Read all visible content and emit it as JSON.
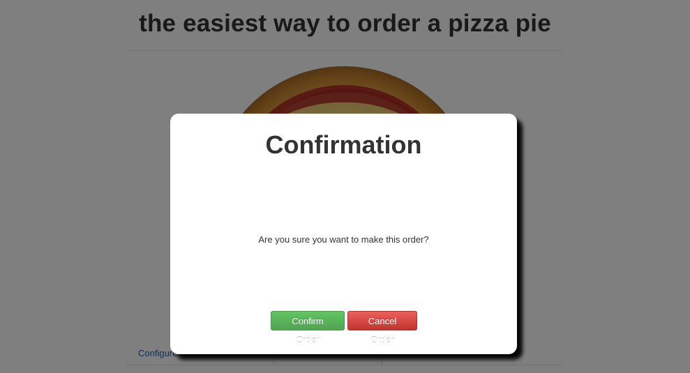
{
  "page": {
    "title": "the easiest way to order a pizza pie",
    "config_link": "Configure"
  },
  "modal": {
    "title": "Confirmation",
    "message": "Are you sure you want to make this order?",
    "confirm_label": "Confirm Order",
    "cancel_label": "Cancel Order"
  },
  "colors": {
    "overlay": "#808080",
    "confirm_button": "#5bb75b",
    "cancel_button": "#da4f49",
    "link": "#2a5db0"
  },
  "icons": {
    "pizza": "pizza-image"
  }
}
